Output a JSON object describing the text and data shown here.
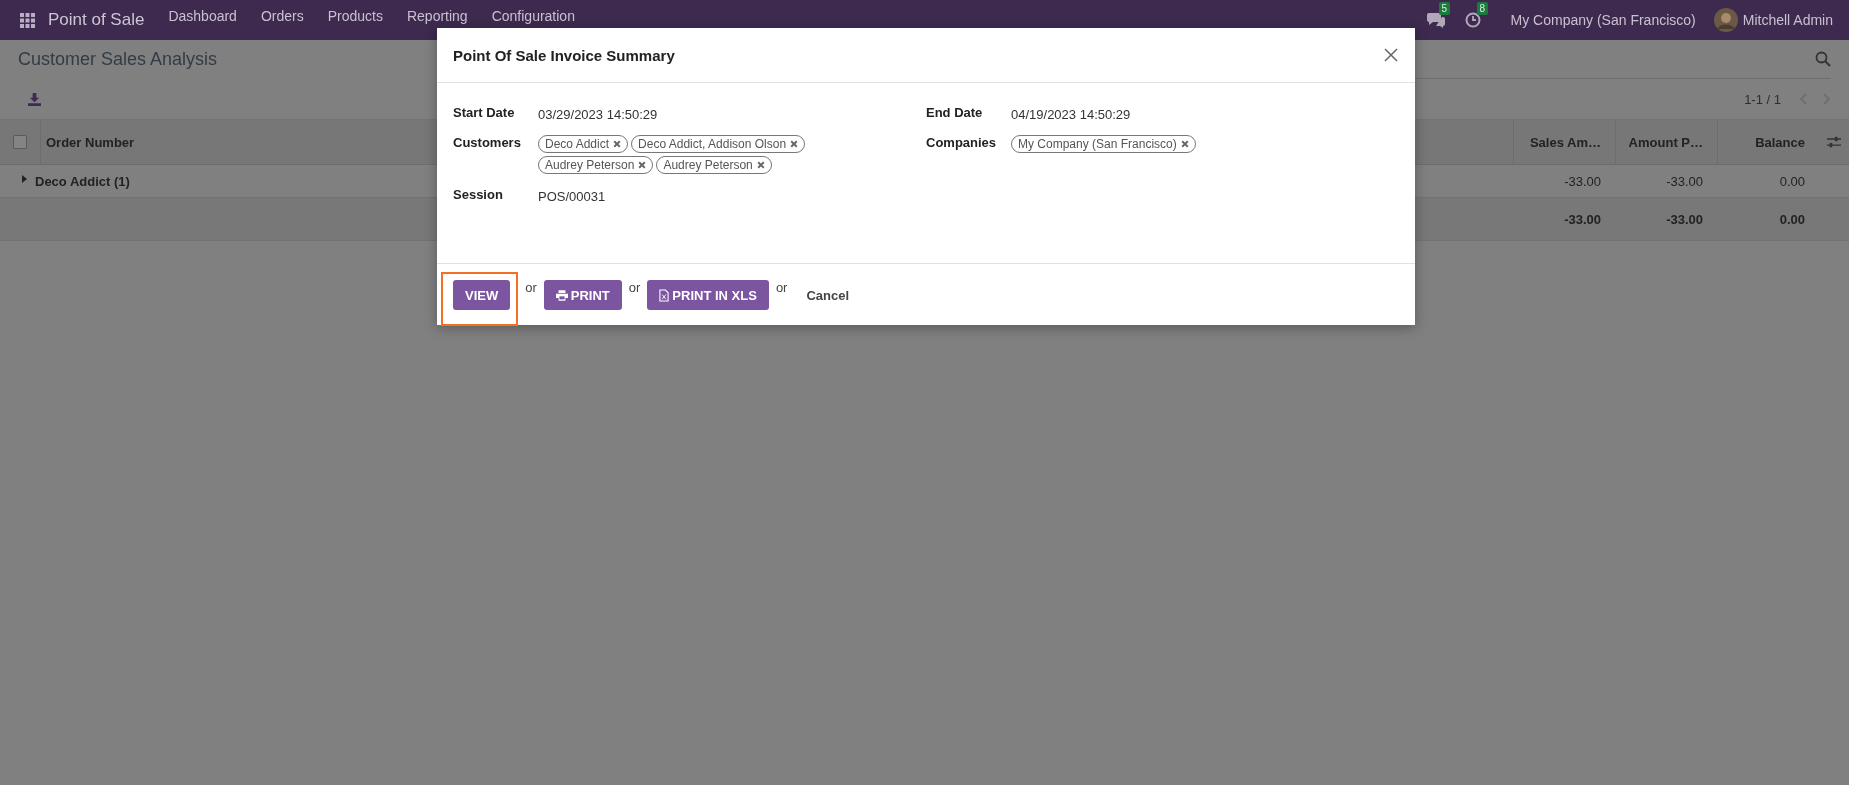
{
  "navbar": {
    "app_name": "Point of Sale",
    "menu": [
      "Dashboard",
      "Orders",
      "Products",
      "Reporting",
      "Configuration"
    ],
    "messages_count": "5",
    "activities_count": "8",
    "company": "My Company (San Francisco)",
    "user": "Mitchell Admin"
  },
  "page": {
    "title": "Customer Sales Analysis",
    "pager": "1-1 / 1",
    "table": {
      "select_all_checked": false,
      "columns": [
        "Order Number",
        "Sales Am…",
        "Amount P…",
        "Balance"
      ],
      "groups": [
        {
          "label": "Deco Addict (1)",
          "expanded": false,
          "values": [
            "-33.00",
            "-33.00",
            "0.00"
          ]
        }
      ],
      "totals": [
        "-33.00",
        "-33.00",
        "0.00"
      ]
    }
  },
  "dialog": {
    "title": "Point Of Sale Invoice Summary",
    "left_fields": [
      {
        "label": "Start Date",
        "kind": "text",
        "value": "03/29/2023 14:50:29"
      },
      {
        "label": "Customers",
        "kind": "tags",
        "tags": [
          "Deco Addict",
          "Deco Addict, Addison Olson",
          "Audrey Peterson",
          "Audrey Peterson"
        ]
      },
      {
        "label": "Session",
        "kind": "text",
        "value": "POS/00031"
      }
    ],
    "right_fields": [
      {
        "label": "End Date",
        "kind": "text",
        "value": "04/19/2023 14:50:29"
      },
      {
        "label": "Companies",
        "kind": "tags",
        "tags": [
          "My Company (San Francisco)"
        ]
      }
    ],
    "footer": [
      {
        "kind": "plain",
        "label": "VIEW",
        "highlighted": true
      },
      {
        "kind": "or",
        "label": "or"
      },
      {
        "kind": "print",
        "label": "PRINT"
      },
      {
        "kind": "or",
        "label": "or"
      },
      {
        "kind": "xls",
        "label": "PRINT IN XLS"
      },
      {
        "kind": "or",
        "label": "or"
      },
      {
        "kind": "link",
        "label": "Cancel"
      }
    ]
  }
}
